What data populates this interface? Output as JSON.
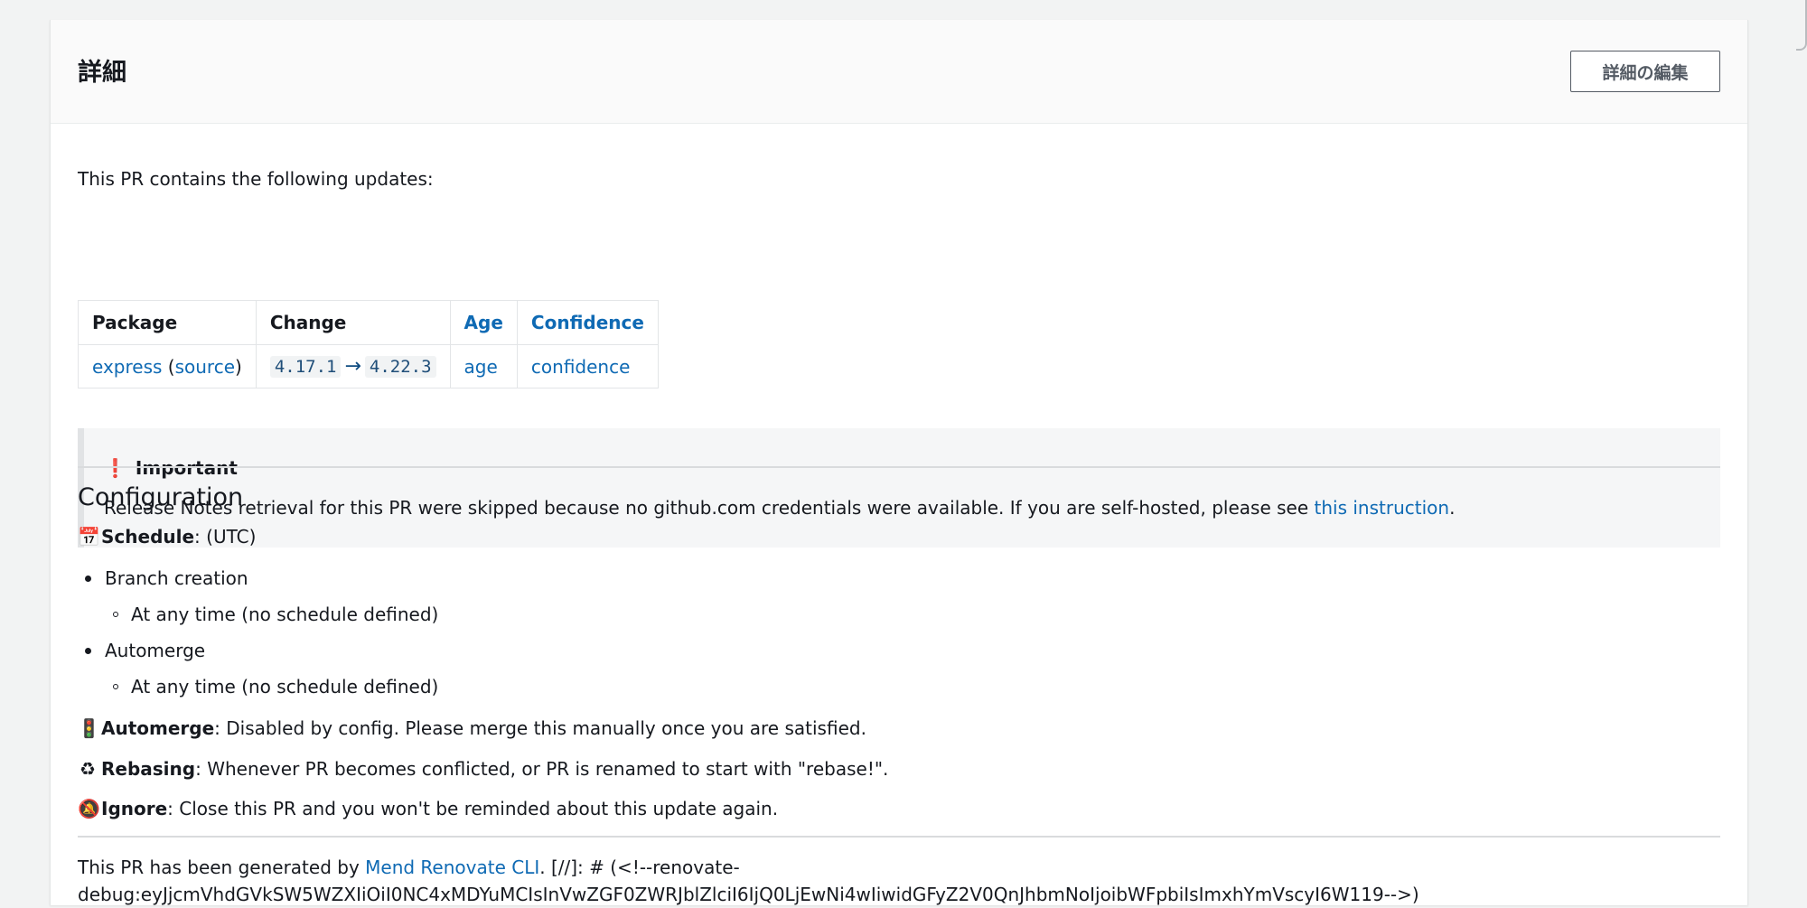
{
  "header": {
    "title": "詳細",
    "edit_button": "詳細の編集"
  },
  "body": {
    "intro": "This PR contains the following updates:",
    "table": {
      "headers": [
        "Package",
        "Change",
        "Age",
        "Confidence"
      ],
      "row": {
        "package_link": "express",
        "open_paren": " (",
        "source_link": "source",
        "close_paren": ")",
        "from_version": "4.17.1",
        "arrow": "→",
        "to_version": "4.22.3",
        "age_link": "age",
        "confidence_link": "confidence"
      }
    },
    "callout": {
      "icon": "❗",
      "title": "Important",
      "text": "Release Notes retrieval for this PR were skipped because no github.com credentials were available. If you are self-hosted, please see ",
      "link": "this instruction",
      "text_end": "."
    },
    "configuration": {
      "title": "Configuration",
      "schedule_icon": "📅",
      "schedule_label": "Schedule",
      "schedule_value": ": (UTC)",
      "items": [
        {
          "label": "Branch creation",
          "sub": "At any time (no schedule defined)"
        },
        {
          "label": "Automerge",
          "sub": "At any time (no schedule defined)"
        }
      ],
      "automerge_icon": "🚦",
      "automerge_label": "Automerge",
      "automerge_value": ": Disabled by config. Please merge this manually once you are satisfied.",
      "rebasing_icon": "♻",
      "rebasing_label": "Rebasing",
      "rebasing_value": ": Whenever PR becomes conflicted, or PR is renamed to start with \"rebase!\".",
      "ignore_icon": "🔕",
      "ignore_label": "Ignore",
      "ignore_value": ": Close this PR and you won't be reminded about this update again."
    },
    "footer": {
      "prefix": "This PR has been generated by ",
      "link": "Mend Renovate CLI",
      "suffix": ". [//]: # (<!--renovate-",
      "debug_line": "debug:eyJjcmVhdGVkSW5WZXIiOiI0NC4xMDYuMCIsInVwZGF0ZWRJblZlciI6IjQ0LjEwNi4wIiwidGFyZ2V0QnJhbmNoIjoibWFpbiIsImxhYmVscyI6W119-->)"
    }
  },
  "colors": {
    "link": "#0f6ab4",
    "important": "#d1242f",
    "page_background": "#f2f3f3"
  }
}
